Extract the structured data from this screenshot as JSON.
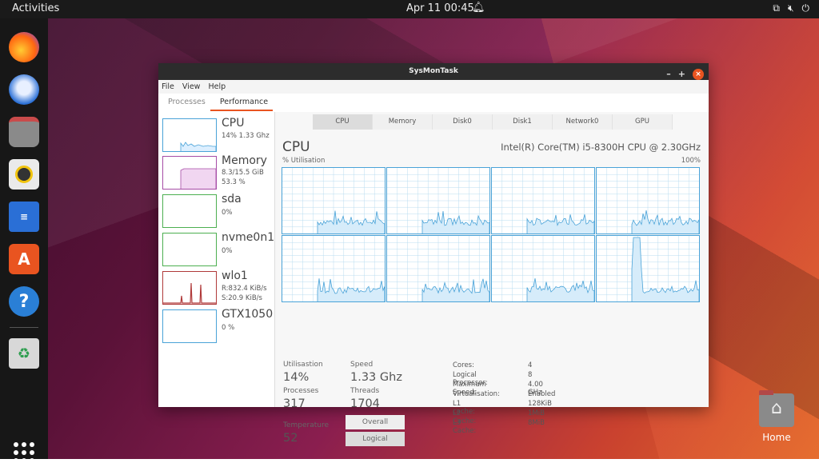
{
  "topbar": {
    "activities": "Activities",
    "clock": "Apr 11  00:45"
  },
  "home": {
    "label": "Home"
  },
  "window": {
    "title": "SysMonTask",
    "controls": {
      "minimize": "–",
      "maximize": "+",
      "close": "×"
    },
    "menu": [
      "File",
      "View",
      "Help"
    ],
    "top_tabs": [
      "Processes",
      "Performance"
    ]
  },
  "sidebar": {
    "items": [
      {
        "title": "CPU",
        "lines": [
          "14% 1.33 Ghz"
        ],
        "color": "#4aa3d8"
      },
      {
        "title": "Memory",
        "lines": [
          "8.3/15.5 GiB",
          "53.3 %"
        ],
        "color": "#a64ca6"
      },
      {
        "title": "sda",
        "lines": [
          "0%"
        ],
        "color": "#4caf50"
      },
      {
        "title": "nvme0n1",
        "lines": [
          "0%"
        ],
        "color": "#4caf50"
      },
      {
        "title": "wlo1",
        "lines": [
          "R:832.4 KiB/s",
          "S:20.9 KiB/s"
        ],
        "color": "#b03a3a"
      },
      {
        "title": "GTX1050",
        "lines": [
          "0 %"
        ],
        "color": "#4aa3d8"
      }
    ]
  },
  "perf_tabs": [
    "CPU",
    "Memory",
    "Disk0",
    "Disk1",
    "Network0",
    "GPU"
  ],
  "cpu": {
    "heading": "CPU",
    "model": "Intel(R) Core(TM) i5-8300H CPU @ 2.30GHz",
    "util_label": "% Utilisation",
    "util_max": "100%",
    "stats": {
      "utilisation_label": "Utilisastion",
      "utilisation": "14%",
      "speed_label": "Speed",
      "speed": "1.33 Ghz",
      "processes_label": "Processes",
      "processes": "317",
      "threads_label": "Threads",
      "threads": "1704",
      "temperature_label": "Temperature",
      "temperature": "52"
    },
    "buttons": {
      "overall": "Overall",
      "logical": "Logical"
    },
    "info": [
      {
        "key": "Cores:",
        "value": "4"
      },
      {
        "key": "Logical Processor:",
        "value": "8"
      },
      {
        "key": "Maximum Speed:",
        "value": "4.00 GHz"
      },
      {
        "key": "Virtualisation:",
        "value": "Enabled"
      },
      {
        "key": "L1 cache:",
        "value": "128KiB"
      },
      {
        "key": "L2 Cache:",
        "value": "1MiB"
      },
      {
        "key": "L3 Cache:",
        "value": "8MiB"
      }
    ]
  },
  "colors": {
    "accent": "#e95420",
    "cpu_line": "#4aa3d8",
    "grid": "#b9dcf0"
  }
}
